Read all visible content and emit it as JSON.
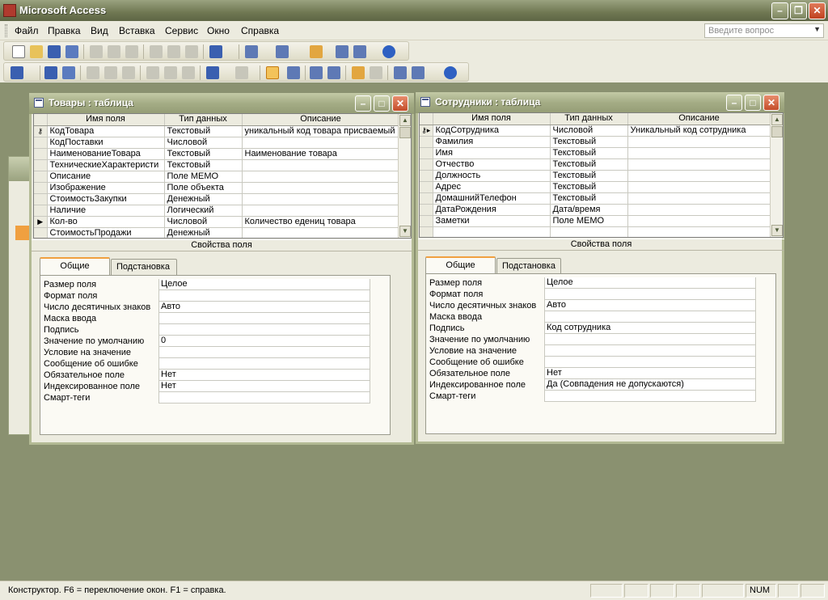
{
  "app": {
    "title": "Microsoft Access"
  },
  "menu": [
    "Файл",
    "Правка",
    "Вид",
    "Вставка",
    "Сервис",
    "Окно",
    "Справка"
  ],
  "help": {
    "placeholder": "Введите вопрос"
  },
  "products": {
    "title": "Товары : таблица",
    "headers": [
      "Имя поля",
      "Тип данных",
      "Описание"
    ],
    "rows": [
      {
        "name": "КодТовара",
        "type": "Текстовый",
        "desc": "уникальный код товара присваемый",
        "marker": "key"
      },
      {
        "name": "КодПоставки",
        "type": "Числовой",
        "desc": ""
      },
      {
        "name": "НаименованиеТовара",
        "type": "Текстовый",
        "desc": "Наименование  товара"
      },
      {
        "name": "ТехническиеХарактеристи",
        "type": "Текстовый",
        "desc": ""
      },
      {
        "name": "Описание",
        "type": "Поле MEMO",
        "desc": ""
      },
      {
        "name": "Изображение",
        "type": "Поле объекта",
        "desc": ""
      },
      {
        "name": "СтоимостьЗакупки",
        "type": "Денежный",
        "desc": ""
      },
      {
        "name": "Наличие",
        "type": "Логический",
        "desc": ""
      },
      {
        "name": "Кол-во",
        "type": "Числовой",
        "desc": "Количество едениц товара",
        "marker": "current"
      },
      {
        "name": "СтоимостьПродажи",
        "type": "Денежный",
        "desc": ""
      }
    ],
    "props_title": "Свойства поля",
    "tabs": [
      "Общие",
      "Подстановка"
    ],
    "props": [
      {
        "label": "Размер поля",
        "value": "Целое"
      },
      {
        "label": "Формат поля",
        "value": ""
      },
      {
        "label": "Число десятичных знаков",
        "value": "Авто"
      },
      {
        "label": "Маска ввода",
        "value": ""
      },
      {
        "label": "Подпись",
        "value": ""
      },
      {
        "label": "Значение по умолчанию",
        "value": "0"
      },
      {
        "label": "Условие на значение",
        "value": ""
      },
      {
        "label": "Сообщение об ошибке",
        "value": ""
      },
      {
        "label": "Обязательное поле",
        "value": "Нет"
      },
      {
        "label": "Индексированное поле",
        "value": "Нет"
      },
      {
        "label": "Смарт-теги",
        "value": ""
      }
    ]
  },
  "employees": {
    "title": "Сотрудники : таблица",
    "headers": [
      "Имя поля",
      "Тип данных",
      "Описание"
    ],
    "rows": [
      {
        "name": "КодСотрудника",
        "type": "Числовой",
        "desc": "Уникальный код сотрудника",
        "marker": "keycurrent"
      },
      {
        "name": "Фамилия",
        "type": "Текстовый",
        "desc": ""
      },
      {
        "name": "Имя",
        "type": "Текстовый",
        "desc": ""
      },
      {
        "name": "Отчество",
        "type": "Текстовый",
        "desc": ""
      },
      {
        "name": "Должность",
        "type": "Текстовый",
        "desc": ""
      },
      {
        "name": "Адрес",
        "type": "Текстовый",
        "desc": ""
      },
      {
        "name": "ДомашнийТелефон",
        "type": "Текстовый",
        "desc": ""
      },
      {
        "name": "ДатаРождения",
        "type": "Дата/время",
        "desc": ""
      },
      {
        "name": "Заметки",
        "type": "Поле MEMO",
        "desc": ""
      },
      {
        "name": "",
        "type": "",
        "desc": ""
      }
    ],
    "props_title": "Свойства поля",
    "tabs": [
      "Общие",
      "Подстановка"
    ],
    "props": [
      {
        "label": "Размер поля",
        "value": "Целое"
      },
      {
        "label": "Формат поля",
        "value": ""
      },
      {
        "label": "Число десятичных знаков",
        "value": "Авто"
      },
      {
        "label": "Маска ввода",
        "value": ""
      },
      {
        "label": "Подпись",
        "value": "Код сотрудника"
      },
      {
        "label": "Значение по умолчанию",
        "value": ""
      },
      {
        "label": "Условие на значение",
        "value": ""
      },
      {
        "label": "Сообщение об ошибке",
        "value": ""
      },
      {
        "label": "Обязательное поле",
        "value": "Нет"
      },
      {
        "label": "Индексированное поле",
        "value": "Да (Совпадения не допускаются)"
      },
      {
        "label": "Смарт-теги",
        "value": ""
      }
    ]
  },
  "status": {
    "text": "Конструктор.  F6 = переключение окон.  F1 = справка.",
    "num": "NUM"
  }
}
